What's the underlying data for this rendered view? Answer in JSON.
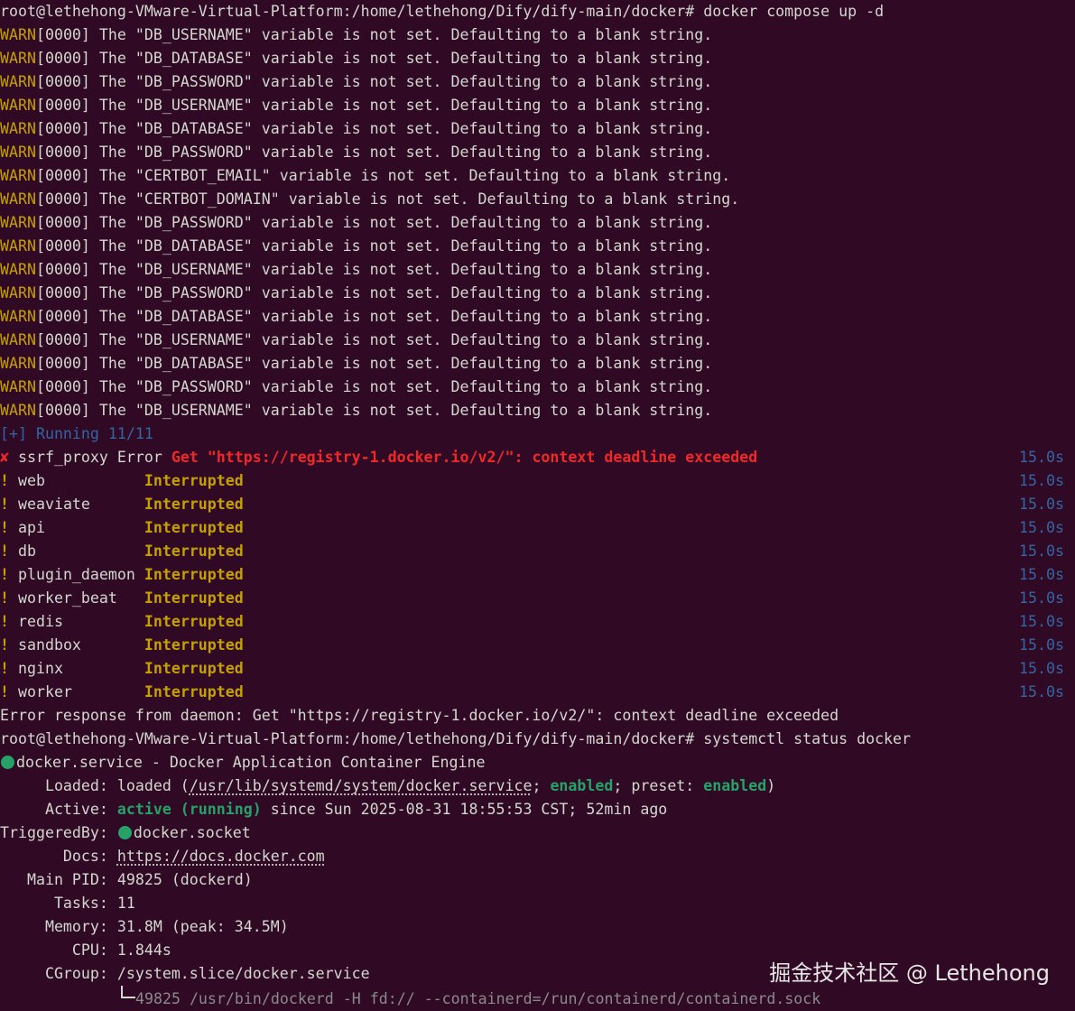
{
  "prompt1": "root@lethehong-VMware-Virtual-Platform:/home/lethehong/Dify/dify-main/docker#",
  "cmd1": " docker compose up -d",
  "warn_label": "WARN",
  "warnings": [
    "[0000] The \"DB_USERNAME\" variable is not set. Defaulting to a blank string.",
    "[0000] The \"DB_DATABASE\" variable is not set. Defaulting to a blank string.",
    "[0000] The \"DB_PASSWORD\" variable is not set. Defaulting to a blank string.",
    "[0000] The \"DB_USERNAME\" variable is not set. Defaulting to a blank string.",
    "[0000] The \"DB_DATABASE\" variable is not set. Defaulting to a blank string.",
    "[0000] The \"DB_PASSWORD\" variable is not set. Defaulting to a blank string.",
    "[0000] The \"CERTBOT_EMAIL\" variable is not set. Defaulting to a blank string.",
    "[0000] The \"CERTBOT_DOMAIN\" variable is not set. Defaulting to a blank string.",
    "[0000] The \"DB_PASSWORD\" variable is not set. Defaulting to a blank string.",
    "[0000] The \"DB_DATABASE\" variable is not set. Defaulting to a blank string.",
    "[0000] The \"DB_USERNAME\" variable is not set. Defaulting to a blank string.",
    "[0000] The \"DB_PASSWORD\" variable is not set. Defaulting to a blank string.",
    "[0000] The \"DB_DATABASE\" variable is not set. Defaulting to a blank string.",
    "[0000] The \"DB_USERNAME\" variable is not set. Defaulting to a blank string.",
    "[0000] The \"DB_DATABASE\" variable is not set. Defaulting to a blank string.",
    "[0000] The \"DB_PASSWORD\" variable is not set. Defaulting to a blank string.",
    "[0000] The \"DB_USERNAME\" variable is not set. Defaulting to a blank string."
  ],
  "running": "[+] Running 11/11",
  "error_service": {
    "icon": "✘",
    "name": " ssrf_proxy Error ",
    "message": "Get \"https://registry-1.docker.io/v2/\": context deadline exceeded",
    "time": "15.0s"
  },
  "services": [
    {
      "icon": "!",
      "name": " web           ",
      "status": "Interrupted",
      "time": "15.0s"
    },
    {
      "icon": "!",
      "name": " weaviate      ",
      "status": "Interrupted",
      "time": "15.0s"
    },
    {
      "icon": "!",
      "name": " api           ",
      "status": "Interrupted",
      "time": "15.0s"
    },
    {
      "icon": "!",
      "name": " db            ",
      "status": "Interrupted",
      "time": "15.0s"
    },
    {
      "icon": "!",
      "name": " plugin_daemon ",
      "status": "Interrupted",
      "time": "15.0s"
    },
    {
      "icon": "!",
      "name": " worker_beat   ",
      "status": "Interrupted",
      "time": "15.0s"
    },
    {
      "icon": "!",
      "name": " redis         ",
      "status": "Interrupted",
      "time": "15.0s"
    },
    {
      "icon": "!",
      "name": " sandbox       ",
      "status": "Interrupted",
      "time": "15.0s"
    },
    {
      "icon": "!",
      "name": " nginx         ",
      "status": "Interrupted",
      "time": "15.0s"
    },
    {
      "icon": "!",
      "name": " worker        ",
      "status": "Interrupted",
      "time": "15.0s"
    }
  ],
  "daemon_error": "Error response from daemon: Get \"https://registry-1.docker.io/v2/\": context deadline exceeded",
  "prompt2": "root@lethehong-VMware-Virtual-Platform:/home/lethehong/Dify/dify-main/docker#",
  "cmd2": " systemctl status docker",
  "status": {
    "unit": "docker.service - Docker Application Container Engine",
    "loaded_label": "     Loaded: ",
    "loaded_pre": "loaded (",
    "loaded_path": "/usr/lib/systemd/system/docker.service",
    "loaded_sep": "; ",
    "enabled1": "enabled",
    "preset_label": "; preset: ",
    "enabled2": "enabled",
    "loaded_post": ")",
    "active_label": "     Active: ",
    "active_value": "active (running)",
    "active_since": " since Sun 2025-08-31 18:55:53 CST; 52min ago",
    "triggered_label": "TriggeredBy: ",
    "triggered_value": "docker.socket",
    "docs_label": "       Docs: ",
    "docs_value": "https://docs.docker.com",
    "pid_label": "   Main PID: ",
    "pid_value": "49825 (dockerd)",
    "tasks_label": "      Tasks: ",
    "tasks_value": "11",
    "memory_label": "     Memory: ",
    "memory_value": "31.8M (peak: 34.5M)",
    "cpu_label": "        CPU: ",
    "cpu_value": "1.844s",
    "cgroup_label": "     CGroup: ",
    "cgroup_value": "/system.slice/docker.service",
    "process": "49825 /usr/bin/dockerd -H fd:// --containerd=/run/containerd/containerd.sock"
  },
  "watermark": "掘金技术社区 @ Lethehong"
}
